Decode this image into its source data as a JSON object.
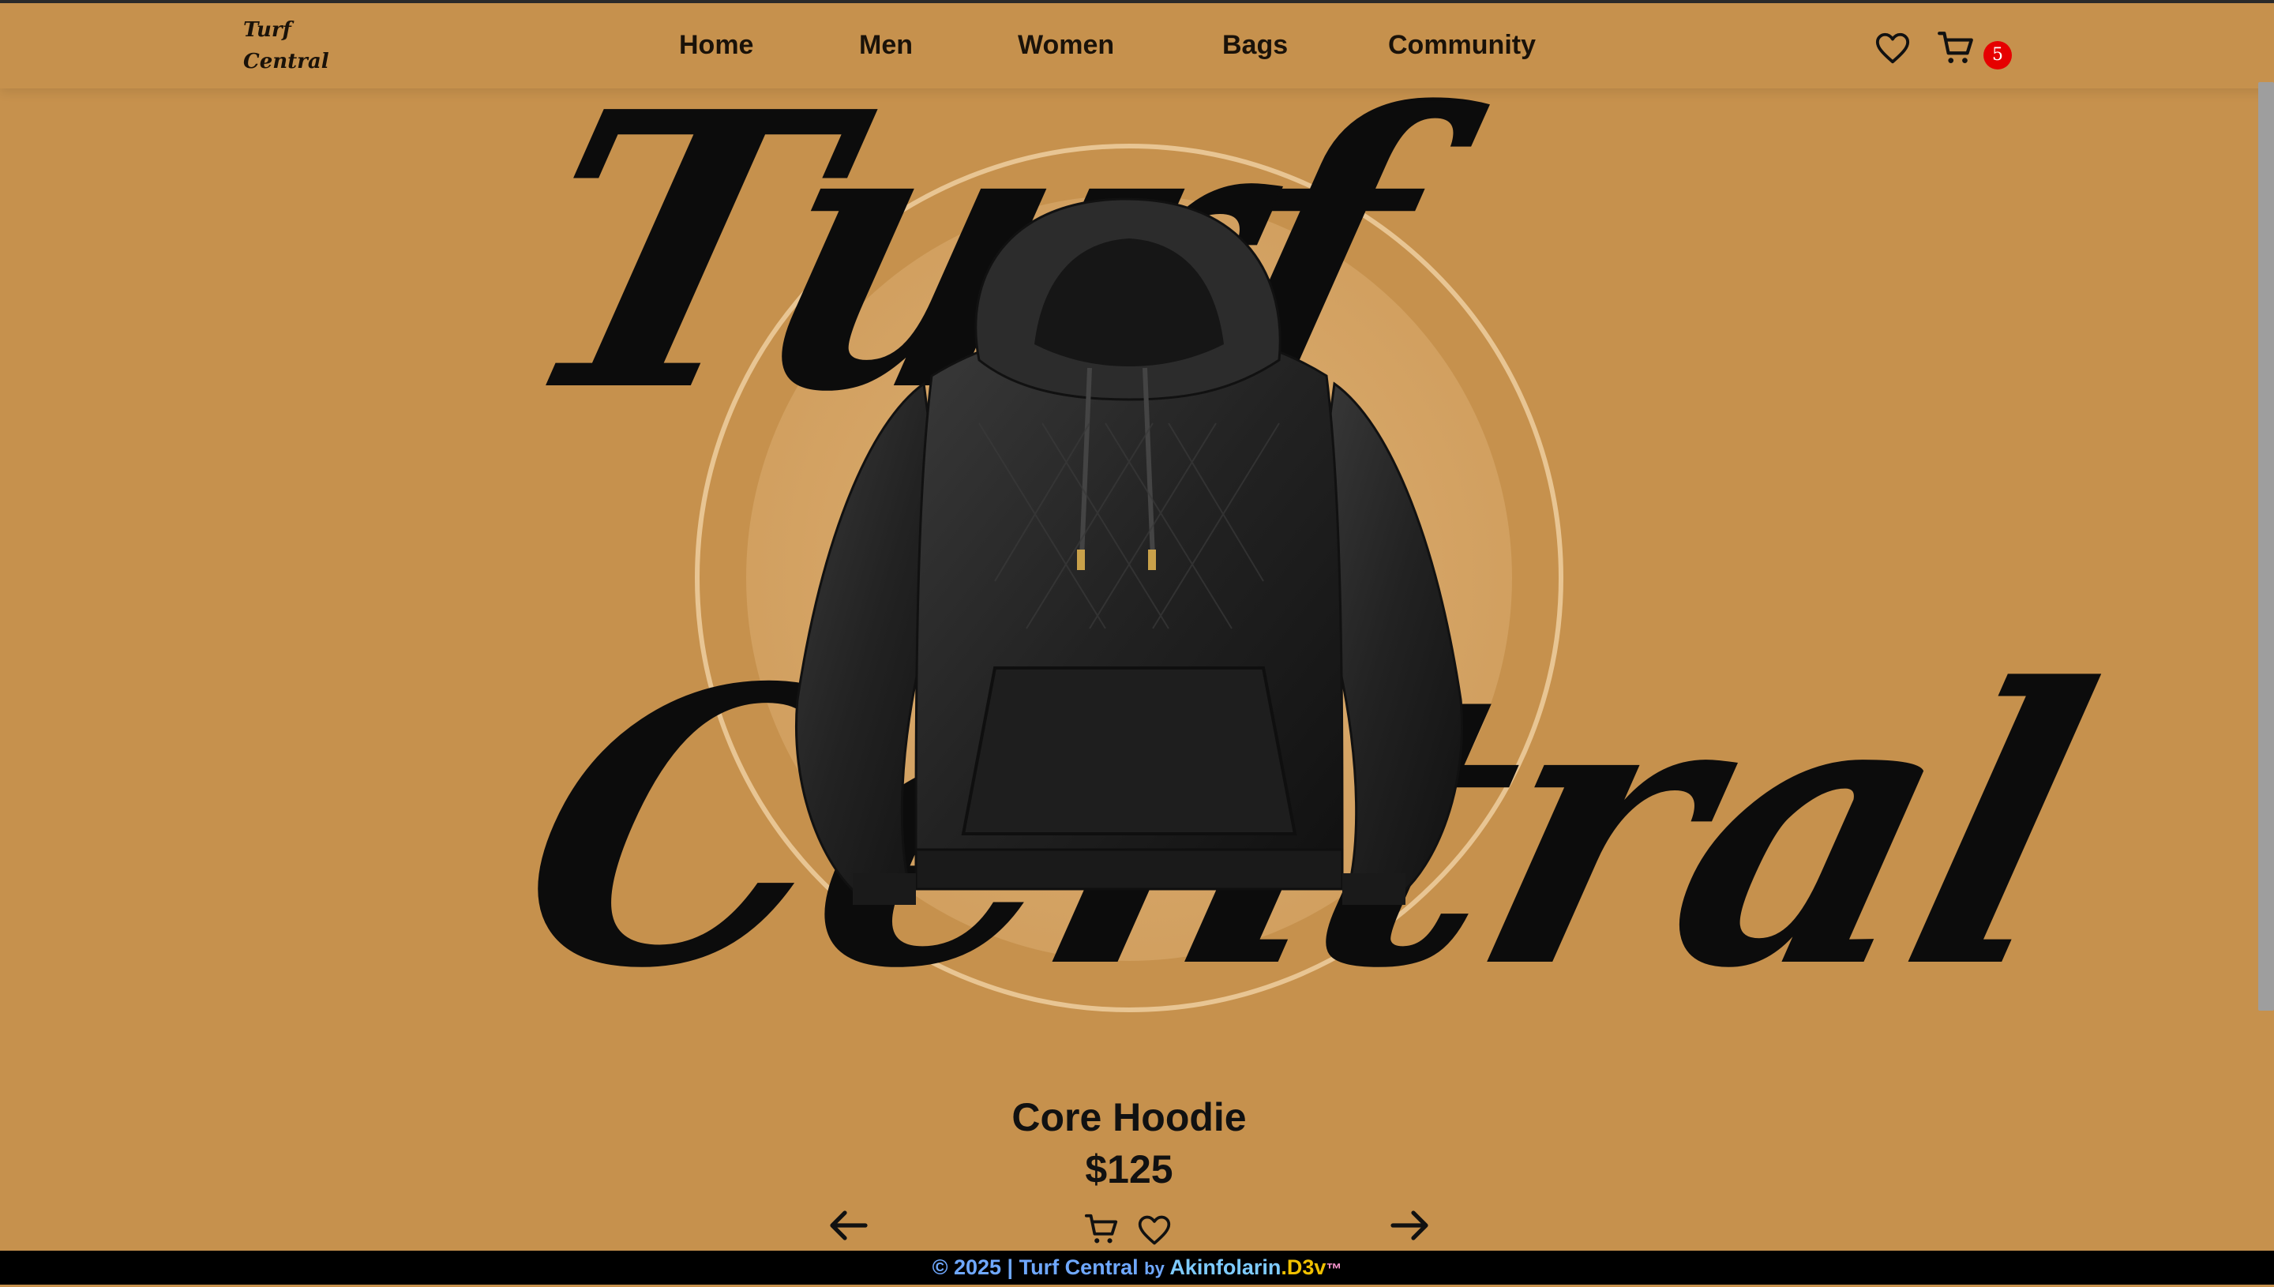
{
  "brand": {
    "logo_line1": "Turf",
    "logo_line2": "Central",
    "hero_word1": "Turf",
    "hero_word2": "Central"
  },
  "nav": {
    "items": [
      {
        "label": "Home"
      },
      {
        "label": "Men"
      },
      {
        "label": "Women"
      },
      {
        "label": "Bags"
      },
      {
        "label": "Community"
      }
    ],
    "cart_count": "5"
  },
  "product": {
    "name": "Core Hoodie",
    "price": "$125"
  },
  "footer": {
    "copyright": "© 2025 | Turf Central",
    "by": "by",
    "author_name": "Akinfolarin",
    "author_suffix": ".D3v",
    "tm": "™"
  },
  "icons": {
    "wishlist": "heart-icon",
    "cart": "cart-icon",
    "prev": "arrow-left-icon",
    "next": "arrow-right-icon"
  },
  "colors": {
    "background": "#c6914d",
    "badge": "#e60000",
    "footer_bg": "#000000",
    "footer_text": "#6fa8ff",
    "footer_accent": "#f0c000"
  }
}
